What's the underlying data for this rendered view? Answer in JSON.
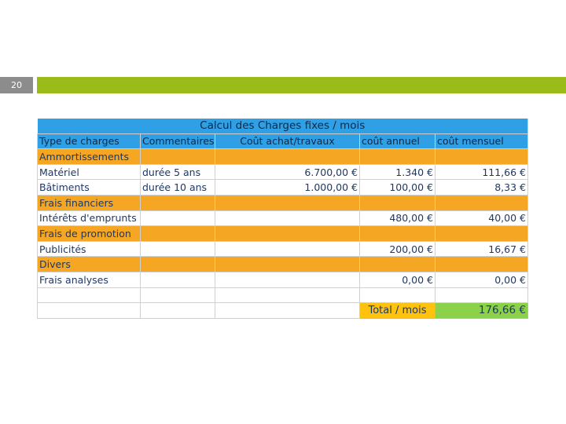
{
  "slide": {
    "number": "20"
  },
  "table": {
    "title": "Calcul des Charges fixes / mois",
    "headers": [
      "Type de charges",
      "Commentaires",
      "Coût achat/travaux",
      "coût annuel",
      "coût mensuel"
    ],
    "rows": [
      {
        "type": "category",
        "label": "Ammortissements"
      },
      {
        "type": "data",
        "cells": [
          "Matériel",
          "durée 5 ans",
          "6.700,00 €",
          "1.340 €",
          "111,66 €"
        ]
      },
      {
        "type": "data",
        "cells": [
          "Bâtiments",
          "durée 10 ans",
          "1.000,00 €",
          "100,00 €",
          "8,33 €"
        ]
      },
      {
        "type": "category",
        "label": "Frais financiers"
      },
      {
        "type": "data",
        "cells": [
          "Intérêts d'emprunts",
          "",
          "",
          "480,00 €",
          "40,00 €"
        ]
      },
      {
        "type": "category",
        "label": "Frais de promotion"
      },
      {
        "type": "data",
        "cells": [
          "Publicités",
          "",
          "",
          "200,00 €",
          "16,67 €"
        ]
      },
      {
        "type": "category",
        "label": "Divers"
      },
      {
        "type": "data",
        "cells": [
          "Frais analyses",
          "",
          "",
          "0,00 €",
          "0,00 €"
        ]
      }
    ],
    "total": {
      "label": "Total / mois",
      "value": "176,66 €"
    }
  },
  "colors": {
    "accent_bar": "#9bbb1b",
    "header_blue": "#2f9fe6",
    "category_orange": "#f5a623",
    "total_label_yellow": "#ffc20e",
    "total_value_green": "#8bd24a"
  }
}
